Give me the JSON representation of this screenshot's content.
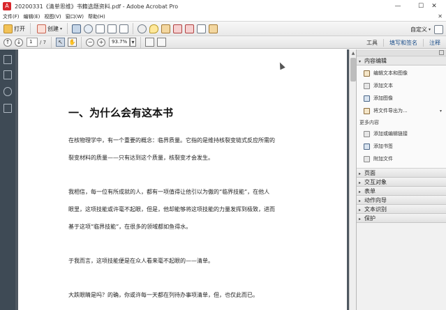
{
  "window": {
    "title": "20200331《清单思维》书籍选题资料.pdf - Adobe Acrobat Pro",
    "app_icon_glyph": "A",
    "controls": {
      "minimize": "—",
      "maximize": "☐",
      "close": "✕"
    }
  },
  "menubar": {
    "items": [
      "文件(F)",
      "编辑(E)",
      "视图(V)",
      "窗口(W)",
      "帮助(H)"
    ],
    "close_glyph": "✕"
  },
  "toolbar": {
    "open_label": "打开",
    "create_label": "创建",
    "customize_label": "自定义",
    "caret": "▾"
  },
  "navbar": {
    "current_page": "1",
    "total_pages": "/ 7",
    "zoom": "93.7%",
    "zoom_out": "−",
    "zoom_in": "+",
    "tabs": [
      "工具",
      "填写和签名",
      "注释"
    ]
  },
  "document": {
    "heading": "一、为什么会有这本书",
    "paragraphs": [
      "在核物理学中，有一个重要的概念：临界质量。它指的是维持核裂变链式反应所需的",
      "裂变材料的质量——只有达到这个质量，核裂变才会发生。",
      "我相信，每一位有所成就的人，都有一项值得让他引以为傲的“临界技能”，在他人",
      "眼里，这项技能或许毫不起眼，但是，他却能够将这项技能的力量发挥到极致，进而",
      "基于这项“临界技能”，在很多的领域都如鱼得水。",
      "于我而言，这项技能便是在众人看来毫不起眼的——清单。",
      "大跌眼睛是吗？的确，你或许每一天都在列待办事项清单，但，也仅此而已。"
    ]
  },
  "right_pane": {
    "content_edit": {
      "title": "内容编辑",
      "items": [
        "编辑文本和图像",
        "添加文本",
        "添加图像",
        "将文件导出为..."
      ]
    },
    "more_content": {
      "title": "更多内容",
      "items": [
        "添加或编辑链接",
        "添加书签",
        "附加文件"
      ]
    },
    "collapsed_sections": [
      "页面",
      "交互对象",
      "表单",
      "动作向导",
      "文本识别",
      "保护"
    ],
    "expanded_marker": "▾",
    "collapsed_marker": "▸"
  },
  "colors": {
    "nav_bg": "#3e4a55",
    "doc_bg": "#4f5861",
    "link_blue": "#1d4f8a"
  }
}
